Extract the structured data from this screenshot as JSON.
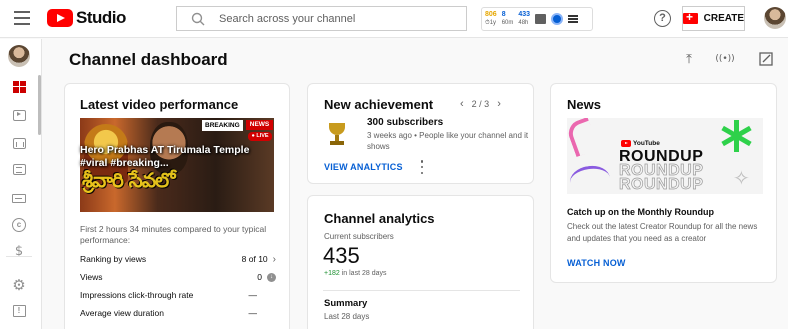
{
  "header": {
    "logo_text": "Studio",
    "search_placeholder": "Search across your channel",
    "stats": {
      "views_value": "806",
      "views_period": "1y",
      "subs_value": "8",
      "subs_period": "60m",
      "realtime_value": "433",
      "realtime_period": "48h"
    },
    "create_label": "CREATE"
  },
  "sidebar": {
    "items": [
      {
        "name": "dashboard",
        "active": true
      },
      {
        "name": "content"
      },
      {
        "name": "analytics"
      },
      {
        "name": "comments"
      },
      {
        "name": "subtitles"
      },
      {
        "name": "copyright"
      },
      {
        "name": "earn"
      },
      {
        "name": "settings"
      },
      {
        "name": "feedback"
      }
    ]
  },
  "page": {
    "title": "Channel dashboard"
  },
  "latest_video": {
    "title": "Latest video performance",
    "thumbnail": {
      "breaking": "BREAKING",
      "news": "NEWS",
      "live": "LIVE",
      "telugu_text": "శ్రీవారి సేవలో",
      "caption": "Hero Prabhas AT Tirumala Temple #viral #breaking..."
    },
    "description": "First 2 hours 34 minutes compared to your typical performance:",
    "rows": [
      {
        "label": "Ranking by views",
        "value": "8 of 10"
      },
      {
        "label": "Views",
        "value": "0"
      },
      {
        "label": "Impressions click-through rate",
        "value": "—"
      },
      {
        "label": "Average view duration",
        "value": "—"
      }
    ]
  },
  "achievement": {
    "title": "New achievement",
    "pager": "2 / 3",
    "headline": "300 subscribers",
    "detail": "3 weeks ago • People like your channel and it shows",
    "link": "VIEW ANALYTICS"
  },
  "analytics": {
    "title": "Channel analytics",
    "current_label": "Current subscribers",
    "current_value": "435",
    "delta_value": "+182",
    "delta_text": "in last 28 days",
    "summary_title": "Summary",
    "summary_period": "Last 28 days"
  },
  "news": {
    "title": "News",
    "banner": {
      "brand": "YouTube",
      "word": "ROUNDUP"
    },
    "headline": "Catch up on the Monthly Roundup",
    "body": "Check out the latest Creator Roundup for all the news and updates that you need as a creator",
    "link": "WATCH NOW"
  },
  "colors": {
    "brand_red": "#ff0000",
    "link_blue": "#065fd4",
    "positive_green": "#1b8f2f"
  }
}
